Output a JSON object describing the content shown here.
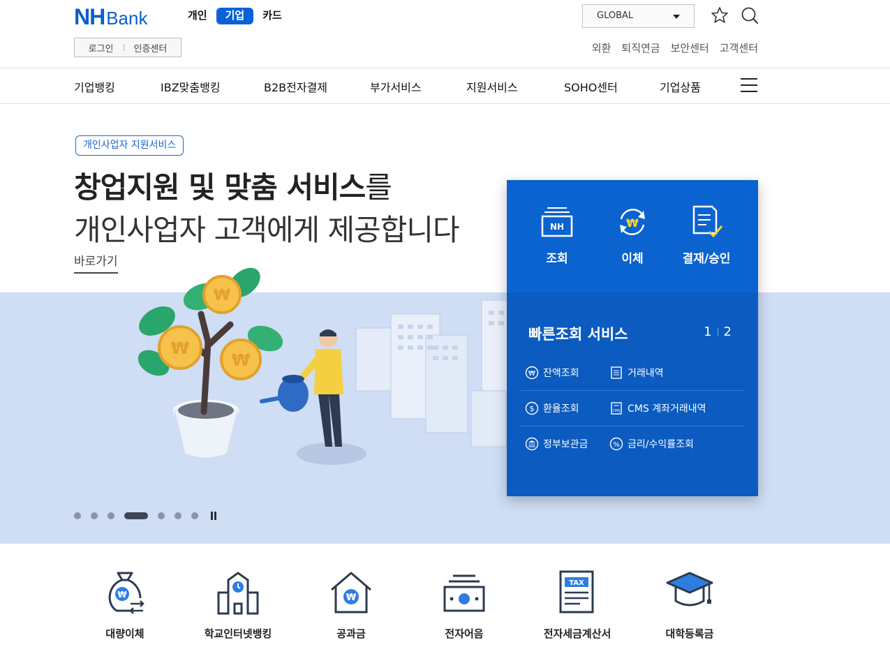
{
  "brand": {
    "logo_main": "NH",
    "logo_sub": "Bank",
    "accent": "#0a62d6"
  },
  "segments": [
    {
      "label": "개인",
      "active": false
    },
    {
      "label": "기업",
      "active": true
    },
    {
      "label": "카드",
      "active": false
    }
  ],
  "global_select": {
    "value": "GLOBAL"
  },
  "auth": {
    "login": "로그인",
    "cert_center": "인증센터"
  },
  "util_links": [
    "외환",
    "퇴직연금",
    "보안센터",
    "고객센터"
  ],
  "gnb": [
    "기업뱅킹",
    "IBZ맞춤뱅킹",
    "B2B전자결제",
    "부가서비스",
    "지원서비스",
    "SOHO센터",
    "기업상품"
  ],
  "hero": {
    "badge": "개인사업자 지원서비스",
    "title_bold": "창업지원 및 맞춤 서비스",
    "title_tail": "를",
    "title_line2": "개인사업자 고객에게 제공합니다",
    "link": "바로가기",
    "slides_total": 7,
    "slide_active": 4
  },
  "quick_panel": {
    "buttons": [
      {
        "label": "조회",
        "icon": "nh-card-icon",
        "icon_text": "NH"
      },
      {
        "label": "이체",
        "icon": "transfer-won-icon",
        "icon_text": "₩"
      },
      {
        "label": "결재/승인",
        "icon": "document-check-icon"
      }
    ],
    "title": "빠른조회 서비스",
    "page_1": "1",
    "page_2": "2",
    "rows": [
      [
        {
          "label": "잔액조회",
          "icon": "won-circle-icon",
          "icon_text": "₩"
        },
        {
          "label": "거래내역",
          "icon": "list-doc-icon"
        }
      ],
      [
        {
          "label": "환율조회",
          "icon": "dollar-circle-icon",
          "icon_text": "$"
        },
        {
          "label": "CMS 계좌거래내역",
          "icon": "cms-doc-icon",
          "icon_text": "CMS"
        }
      ],
      [
        {
          "label": "정부보관금",
          "icon": "bank-building-icon"
        },
        {
          "label": "금리/수익률조회",
          "icon": "percent-circle-icon",
          "icon_text": "%"
        }
      ]
    ]
  },
  "services": [
    {
      "label": "대량이체",
      "icon": "money-bag-transfer-icon",
      "icon_text": "₩"
    },
    {
      "label": "학교인터넷뱅킹",
      "icon": "school-clock-icon"
    },
    {
      "label": "공과금",
      "icon": "house-won-icon",
      "icon_text": "₩"
    },
    {
      "label": "전자어음",
      "icon": "bill-note-icon"
    },
    {
      "label": "전자세금계산서",
      "icon": "tax-invoice-icon",
      "icon_text": "TAX"
    },
    {
      "label": "대학등록금",
      "icon": "graduation-cap-icon"
    }
  ]
}
